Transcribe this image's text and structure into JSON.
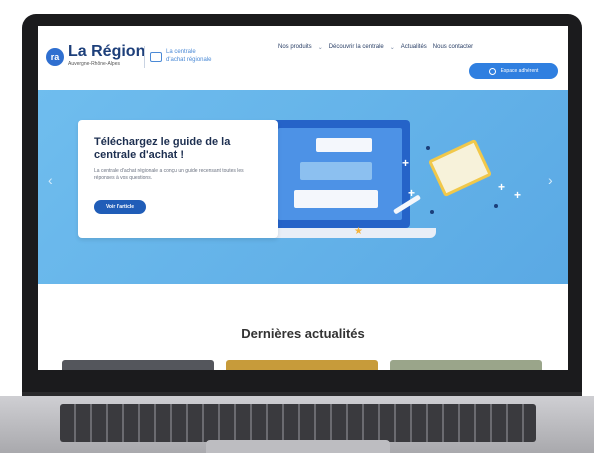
{
  "brand": {
    "logo_mark": "ra",
    "name": "La Région",
    "subtitle": "Auvergne-Rhône-Alpes",
    "central_line1": "La centrale",
    "central_line2": "d'achat régionale"
  },
  "nav": {
    "items": [
      "Nos produits",
      "Découvrir la centrale",
      "Actualités",
      "Nous contacter"
    ],
    "chevron": "⌄"
  },
  "account_button": {
    "label": "Espace adhérent",
    "icon": "user-icon"
  },
  "hero": {
    "title": "Téléchargez le guide de la centrale d'achat !",
    "description": "La centrale d'achat régionale a conçu un guide recensant toutes les réponses à vos questions.",
    "button": "Voir l'article",
    "prev_arrow": "‹",
    "next_arrow": "›"
  },
  "news": {
    "title": "Dernières actualités"
  },
  "colors": {
    "brand_blue": "#2f6fd0",
    "hero_blue": "#68b7ea",
    "button_dark": "#205db8",
    "accent_yellow": "#f1c84a"
  }
}
